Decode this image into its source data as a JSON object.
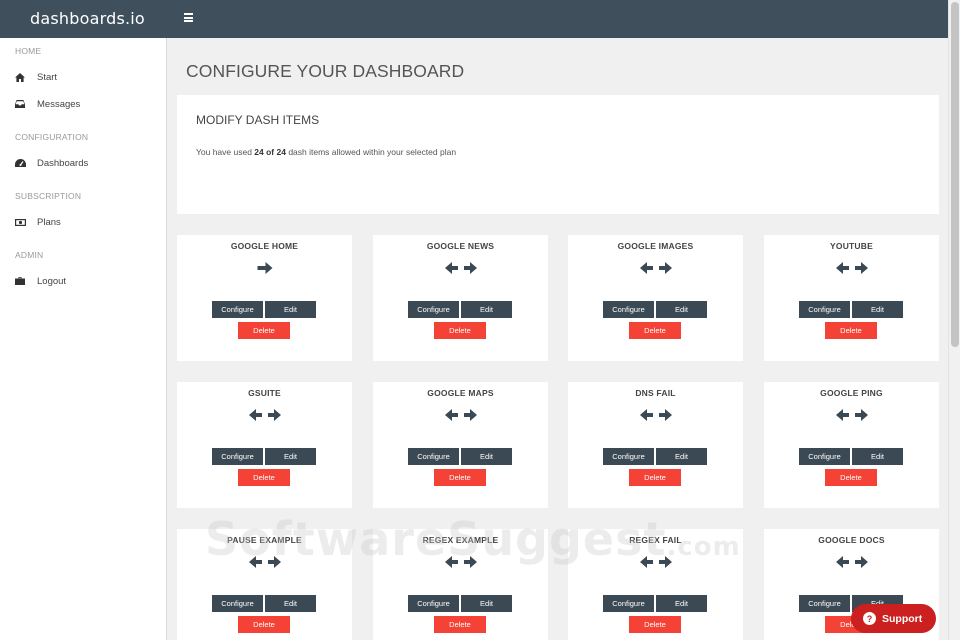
{
  "app": {
    "brand": "dashboards.io"
  },
  "sidebar": {
    "sections": [
      {
        "label": "HOME",
        "items": [
          {
            "label": "Start",
            "icon": "home-icon"
          },
          {
            "label": "Messages",
            "icon": "inbox-icon"
          }
        ]
      },
      {
        "label": "CONFIGURATION",
        "items": [
          {
            "label": "Dashboards",
            "icon": "dashboard-icon"
          }
        ]
      },
      {
        "label": "SUBSCRIPTION",
        "items": [
          {
            "label": "Plans",
            "icon": "money-icon"
          }
        ]
      },
      {
        "label": "ADMIN",
        "items": [
          {
            "label": "Logout",
            "icon": "briefcase-icon"
          }
        ]
      }
    ]
  },
  "page": {
    "title": "CONFIGURE YOUR DASHBOARD"
  },
  "panel": {
    "title": "MODIFY DASH ITEMS",
    "text_before": "You have used ",
    "text_bold": "24 of 24",
    "text_after": " dash items allowed within your selected plan"
  },
  "buttons": {
    "configure": "Configure",
    "edit": "Edit",
    "delete": "Delete"
  },
  "cards": [
    {
      "title": "GOOGLE HOME",
      "arrow": "right-arrow-icon"
    },
    {
      "title": "GOOGLE NEWS",
      "arrow": "left-right-arrows-icon"
    },
    {
      "title": "GOOGLE IMAGES",
      "arrow": "left-right-arrows-icon"
    },
    {
      "title": "YOUTUBE",
      "arrow": "left-right-arrows-icon"
    },
    {
      "title": "GSUITE",
      "arrow": "left-right-arrows-icon"
    },
    {
      "title": "GOOGLE MAPS",
      "arrow": "left-right-arrows-icon"
    },
    {
      "title": "DNS FAIL",
      "arrow": "left-right-arrows-icon"
    },
    {
      "title": "GOOGLE PING",
      "arrow": "left-right-arrows-icon"
    },
    {
      "title": "PAUSE EXAMPLE",
      "arrow": "left-right-arrows-icon"
    },
    {
      "title": "REGEX EXAMPLE",
      "arrow": "left-right-arrows-icon"
    },
    {
      "title": "REGEX FAIL",
      "arrow": "left-right-arrows-icon"
    },
    {
      "title": "GOOGLE DOCS",
      "arrow": "left-right-arrows-icon"
    }
  ],
  "watermark": {
    "main": "SoftwareSuggest",
    "suffix": ".com"
  },
  "support": {
    "label": "Support"
  },
  "colors": {
    "topbar": "#3f4f5c",
    "button_dark": "#3a4954",
    "delete": "#f44336",
    "support": "#cc1f1f"
  }
}
